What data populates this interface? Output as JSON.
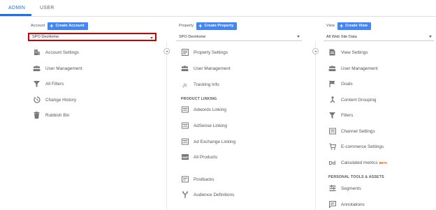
{
  "tabs": {
    "admin": "ADMIN",
    "user": "USER"
  },
  "account": {
    "label": "Account",
    "create": "Create Account",
    "selected": "SPO DevHome",
    "items": [
      "Account Settings",
      "User Management",
      "All Filters",
      "Change History",
      "Rubbish Bin"
    ]
  },
  "property": {
    "label": "Property",
    "create": "Create Property",
    "selected": "SPO DevHome",
    "items": [
      "Property Settings",
      "User Management",
      "Tracking Info"
    ],
    "section_product_linking": "PRODUCT LINKING",
    "linking_items": [
      "Adwords Linking",
      "AdSense Linking",
      "Ad Exchange Linking",
      "All Products"
    ],
    "more_items": [
      "Postbacks",
      "Audience Definitions"
    ]
  },
  "view": {
    "label": "View",
    "create": "Create View",
    "selected": "All Web Site Data",
    "items": [
      "View Settings",
      "User Management",
      "Goals",
      "Content Grouping",
      "Filters",
      "Channel Settings",
      "E-commerce Settings",
      "Calculated metrics"
    ],
    "beta": "BETA",
    "section_personal": "PERSONAL TOOLS & ASSETS",
    "personal_items": [
      "Segments",
      "Annotations"
    ]
  },
  "icons": {
    "account_settings": "building-icon",
    "user_management": "people-icon",
    "filters": "funnel-icon",
    "change_history": "history-icon",
    "rubbish_bin": "trash-icon",
    "tracking": "js-icon",
    "dd": "Dd",
    "all_products": "GMP"
  },
  "colors": {
    "accent": "#1a73e8",
    "button": "#4285f4",
    "highlight": "#cc0000",
    "beta": "#e65100"
  }
}
